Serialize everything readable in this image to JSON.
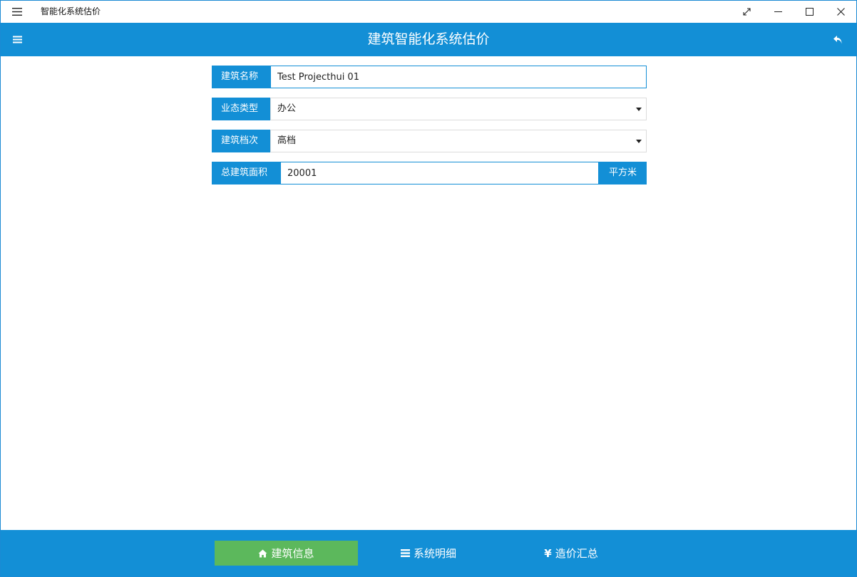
{
  "window": {
    "title": "智能化系统估价",
    "controls": [
      "fullscreen-icon",
      "minimize-icon",
      "maximize-icon",
      "close-icon"
    ]
  },
  "header": {
    "title": "建筑智能化系统估价",
    "menu_icon": "hamburger-icon",
    "back_icon": "undo-arrow-icon"
  },
  "form": {
    "building_name": {
      "label": "建筑名称",
      "value": "Test Projecthui 01"
    },
    "business_type": {
      "label": "业态类型",
      "value": "办公"
    },
    "building_grade": {
      "label": "建筑档次",
      "value": "高档"
    },
    "total_area": {
      "label": "总建筑面积",
      "value": "20001",
      "unit": "平方米"
    }
  },
  "bottom_nav": {
    "items": [
      {
        "label": "建筑信息",
        "icon": "home-icon",
        "active": true
      },
      {
        "label": "系统明细",
        "icon": "list-icon",
        "active": false
      },
      {
        "label": "造价汇总",
        "icon": "yen-icon",
        "active": false
      }
    ]
  },
  "colors": {
    "primary": "#138fd6",
    "active_tab": "#5cb85c",
    "background": "#ffffff"
  }
}
